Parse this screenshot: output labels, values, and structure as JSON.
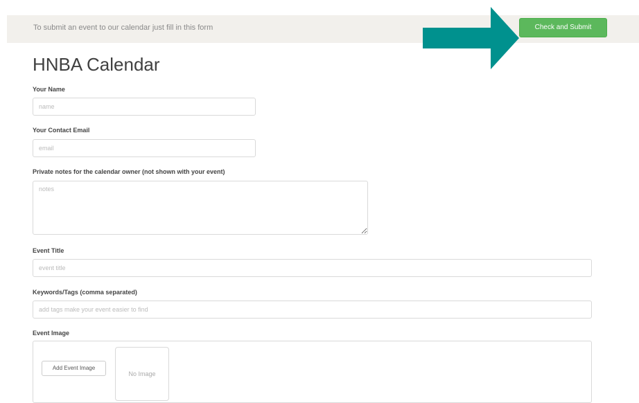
{
  "header": {
    "intro_text": "To submit an event to our calendar just fill in this form",
    "submit_label": "Check and Submit"
  },
  "page": {
    "title": "HNBA Calendar"
  },
  "form": {
    "name": {
      "label": "Your Name",
      "placeholder": "name",
      "value": ""
    },
    "email": {
      "label": "Your Contact Email",
      "placeholder": "email",
      "value": ""
    },
    "notes": {
      "label": "Private notes for the calendar owner (not shown with your event)",
      "placeholder": "notes",
      "value": ""
    },
    "event_title": {
      "label": "Event Title",
      "placeholder": "event title",
      "value": ""
    },
    "tags": {
      "label": "Keywords/Tags (comma separated)",
      "placeholder": "add tags make your event easier to find",
      "value": ""
    },
    "image": {
      "label": "Event Image",
      "add_button_label": "Add Event Image",
      "preview_text": "No Image"
    }
  },
  "colors": {
    "accent_arrow": "#00918e",
    "submit_green": "#5cb85c",
    "header_bg": "#f2f0ec"
  },
  "icons": {
    "arrow": "arrow-right-icon"
  }
}
